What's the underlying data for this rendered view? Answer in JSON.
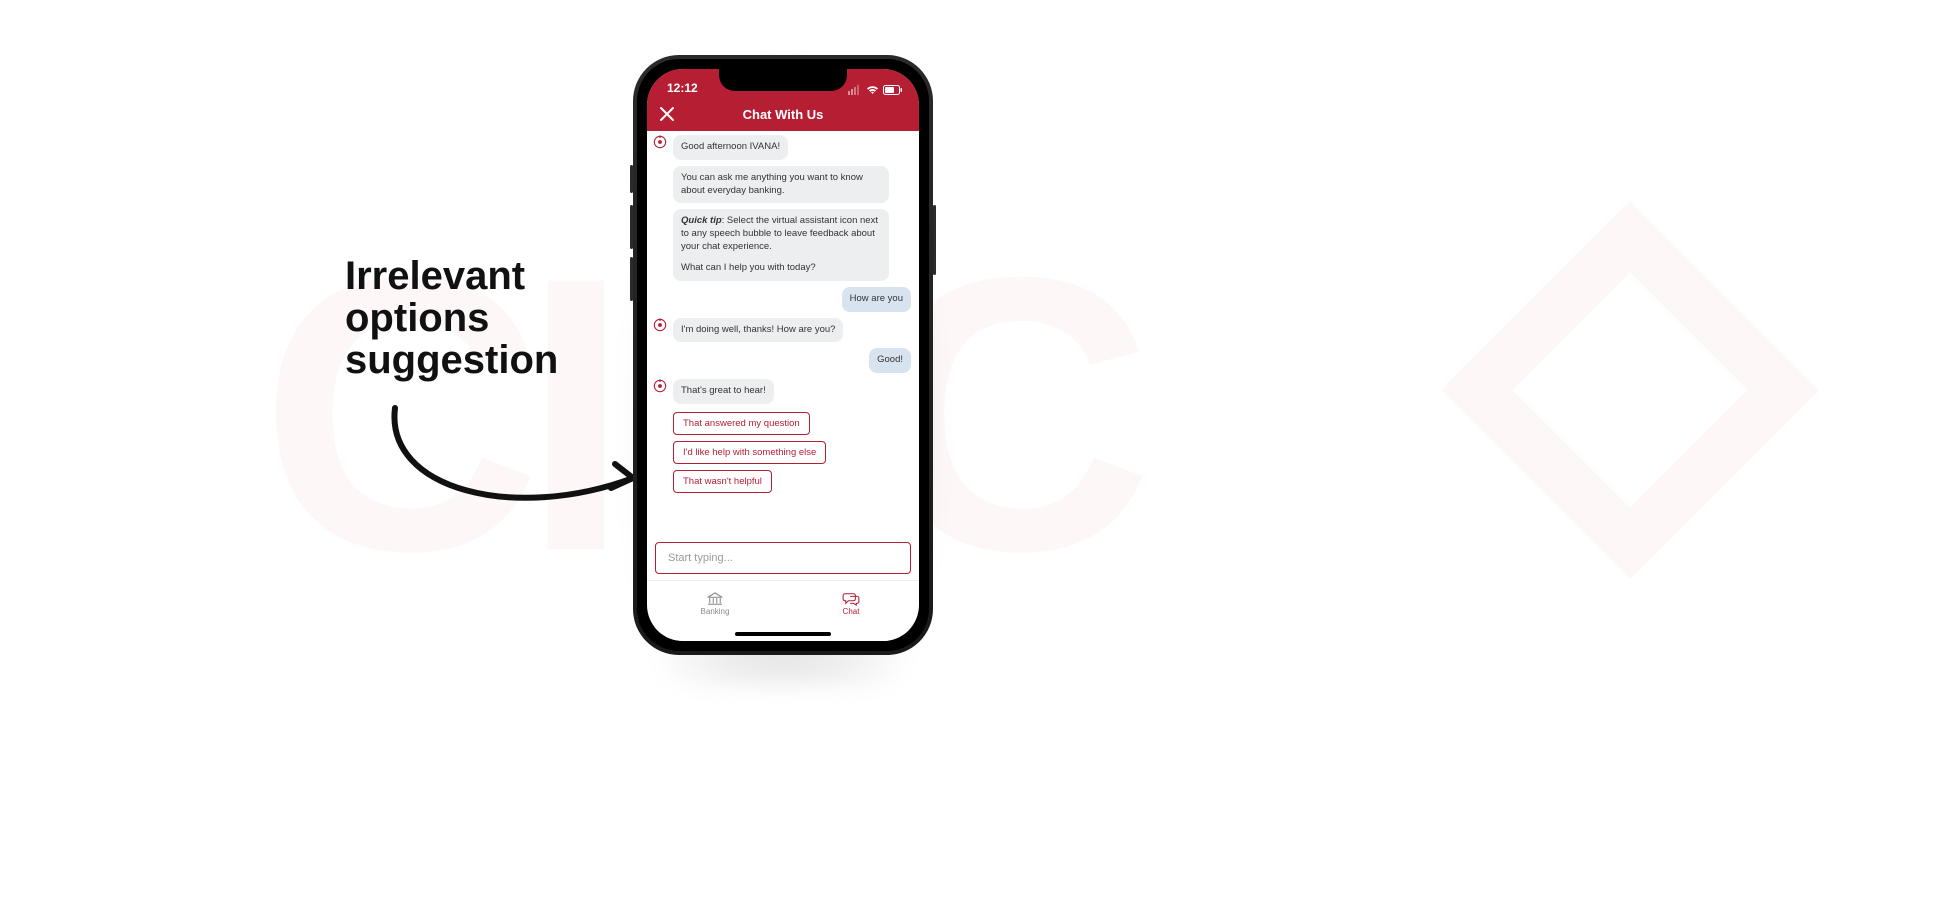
{
  "annotation": {
    "line1": "Irrelevant",
    "line2": "options",
    "line3": "suggestion"
  },
  "status": {
    "time": "12:12"
  },
  "header": {
    "title": "Chat With Us"
  },
  "chat": {
    "bot_greeting": "Good afternoon IVANA!",
    "bot_intro": "You can ask me anything you want to know about everyday banking.",
    "quick_tip_label": "Quick tip",
    "quick_tip_text": ": Select the virtual assistant icon next to any speech bubble to leave feedback about your chat experience.",
    "bot_prompt": "What can I help you with today?",
    "user_msg1": "How are you",
    "bot_reply1": "I'm doing well, thanks! How are you?",
    "user_msg2": "Good!",
    "bot_reply2": "That's great to hear!",
    "chips": [
      "That answered my question",
      "I'd like help with something else",
      "That wasn't helpful"
    ]
  },
  "input": {
    "placeholder": "Start typing..."
  },
  "tabs": {
    "banking": "Banking",
    "chat": "Chat"
  },
  "colors": {
    "brand": "#b61e34",
    "bot_bubble": "#eceeef",
    "user_bubble": "#d7e4f0"
  }
}
